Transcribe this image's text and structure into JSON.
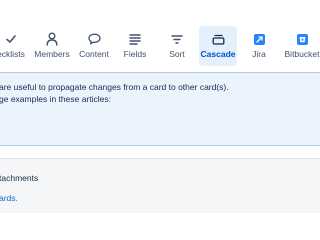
{
  "toolbar": {
    "items": [
      {
        "label": "ecklists",
        "icon": "checkmark-icon"
      },
      {
        "label": "Members",
        "icon": "person-icon"
      },
      {
        "label": "Content",
        "icon": "speech-bubble-icon"
      },
      {
        "label": "Fields",
        "icon": "list-lines-icon"
      },
      {
        "label": "Sort",
        "icon": "sort-icon"
      },
      {
        "label": "Cascade",
        "icon": "cascade-icon",
        "active": true
      },
      {
        "label": "Jira",
        "icon": "jira-logo-icon"
      },
      {
        "label": "Bitbucket",
        "icon": "bitbucket-logo-icon"
      }
    ]
  },
  "info": {
    "line1": "are useful to propagate changes from a card to other card(s).",
    "line2": "ge examples in these articles:"
  },
  "attachments": {
    "label": "tachments",
    "link": "ards."
  },
  "colors": {
    "accent": "#0052cc",
    "active_bg": "#e4f0fb",
    "info_bg": "#ebf4fd",
    "grey_bg": "#f5f6f7",
    "link": "#0b6bcb",
    "jira_blue": "#2684ff",
    "bitbucket_blue": "#2684ff"
  }
}
